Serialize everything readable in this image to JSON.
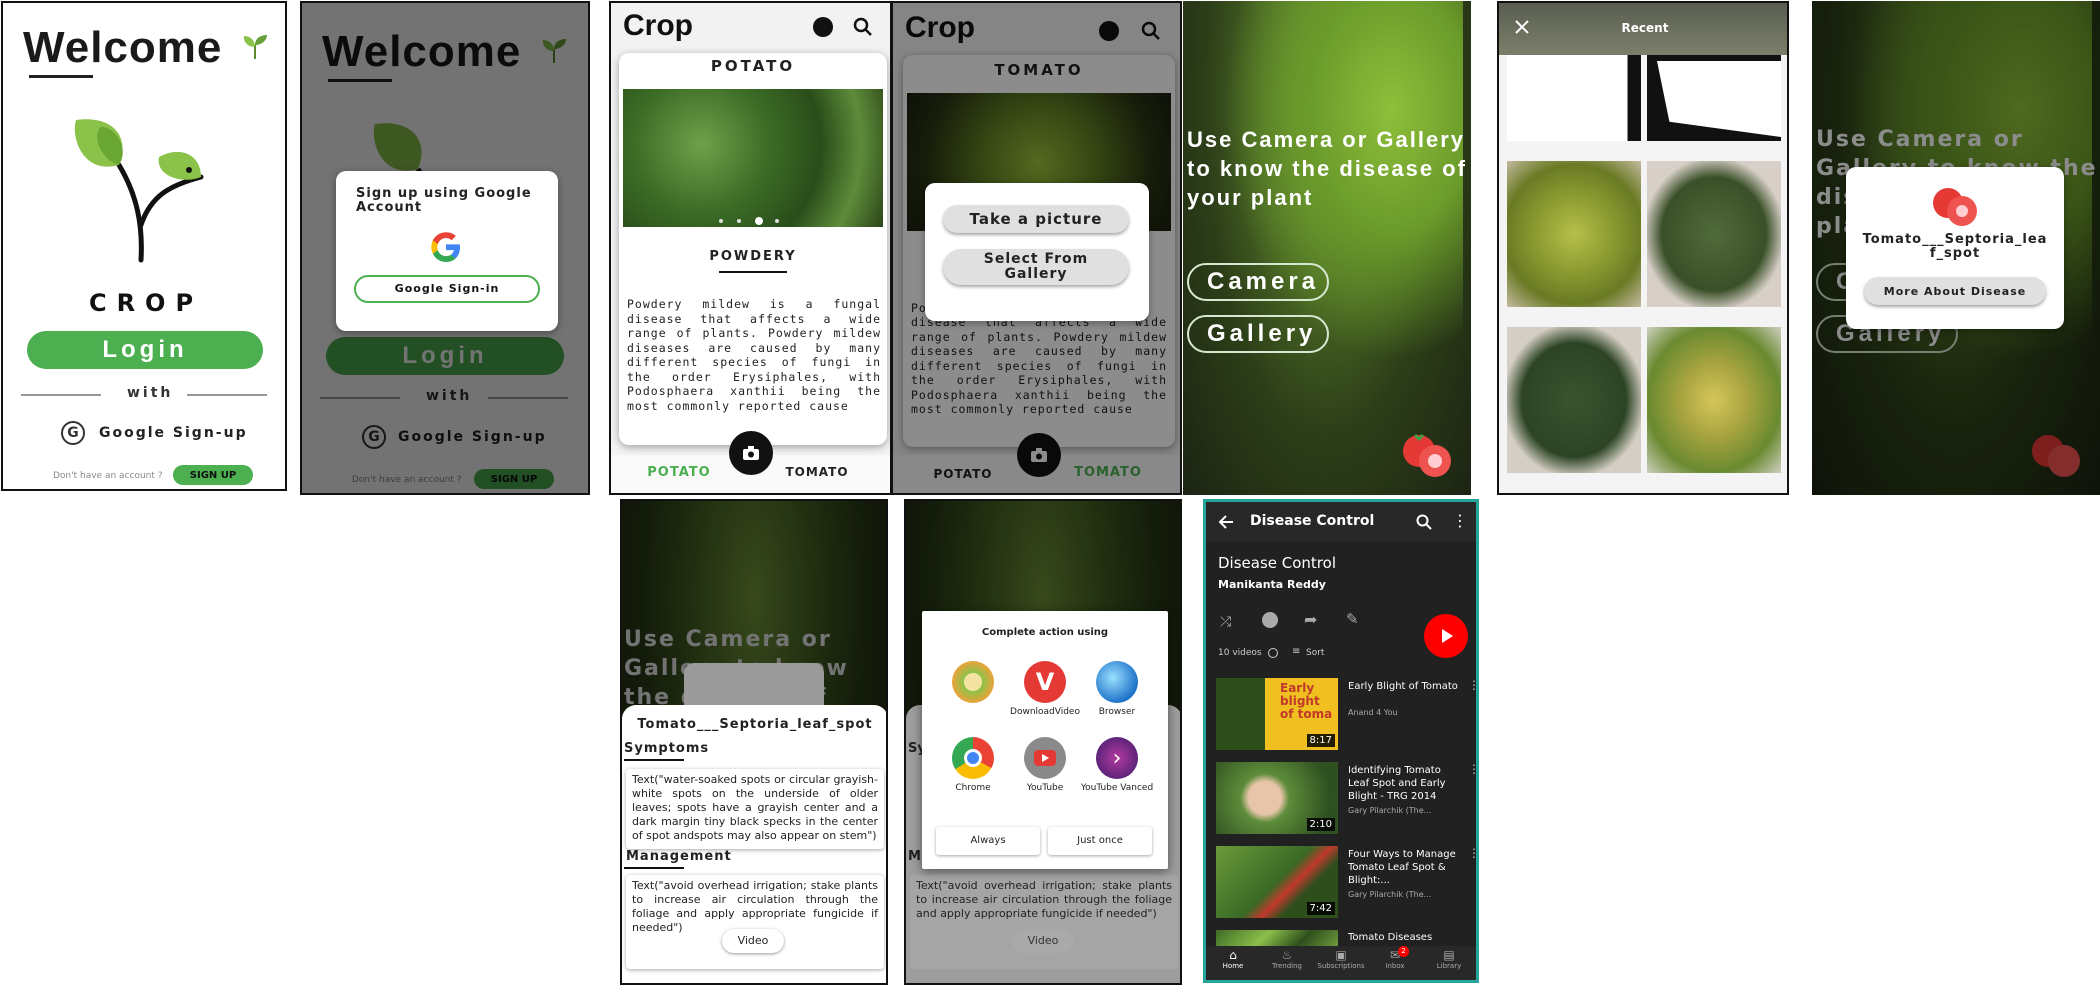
{
  "screen1": {
    "title": "Welcome",
    "brand": "CROP",
    "login": "Login",
    "with": "with",
    "google_signup": "Google Sign-up",
    "no_account": "Don't have an account ?",
    "signup": "SIGN UP",
    "icons": [
      "sprout-icon",
      "plant-logo-icon",
      "google-icon"
    ]
  },
  "screen2": {
    "dialog_title": "Sign up using Google Account",
    "google_signin": "Google Sign-in",
    "icons": [
      "google-g-icon"
    ]
  },
  "screen3": {
    "app_title": "Crop",
    "card_title": "POTATO",
    "disease_title": "POWDERY",
    "desc": "Powdery mildew is a fungal disease that affects a wide range of plants. Powdery mildew diseases are caused by many different species of fungi in the order Erysiphales, with Podosphaera xanthii being the most commonly reported cause",
    "tabs": [
      "POTATO",
      "TOMATO"
    ],
    "icons": [
      "face-icon",
      "search-icon",
      "camera-icon"
    ]
  },
  "screen4": {
    "app_title": "Crop",
    "card_title": "TOMATO",
    "take_picture": "Take a picture",
    "select_gallery": "Select From Gallery",
    "desc": "disease that affects a wide range of plants. Powdery mildew diseases are caused by many different species of fungi in the order Erysiphales, with Podosphaera xanthii being the most commonly reported cause",
    "desc_first": "Po",
    "tabs": [
      "POTATO",
      "TOMATO"
    ]
  },
  "screen5": {
    "headline": "Use Camera or Gallery to know the disease of your plant",
    "camera": "Camera",
    "gallery": "Gallery",
    "icons": [
      "tomato-icon"
    ]
  },
  "screen6": {
    "title": "Recent",
    "icons": [
      "close-icon"
    ]
  },
  "screen7": {
    "disease_name": "Tomato___Septoria_leaf_spot",
    "more": "More About Disease"
  },
  "screen8": {
    "title": "Tomato___Septoria_leaf_spot",
    "symptoms_label": "Symptoms",
    "symptoms_text": "Text(\"water-soaked spots or circular grayish-white spots on the underside of older leaves; spots have a grayish center and a dark margin tiny black specks in the center of spot andspots may also appear on stem\")",
    "management_label": "Management",
    "management_text": "Text(\"avoid overhead irrigation; stake plants to increase air circulation through the foliage and apply appropriate fungicide if needed\")",
    "video": "Video"
  },
  "screen9": {
    "dialog_title": "Complete action using",
    "apps": [
      "",
      "DownloadVideo",
      "Browser",
      "Chrome",
      "YouTube",
      "YouTube Vanced"
    ],
    "always": "Always",
    "just_once": "Just once",
    "sy": "Sy",
    "m": "M",
    "management_text": "Text(\"avoid overhead irrigation; stake plants to increase air circulation through the foliage and apply appropriate fungicide if needed\")",
    "video": "Video"
  },
  "youtube": {
    "header": "Disease Control",
    "playlist_title": "Disease Control",
    "owner": "Manikanta Reddy",
    "count": "10 videos",
    "sort": "Sort",
    "videos": [
      {
        "title": "Early Blight of Tomato",
        "channel": "Anand 4 You",
        "duration": "8:17",
        "thumb_text": "Early blight of toma"
      },
      {
        "title": "Identifying Tomato Leaf Spot and Early Blight - TRG 2014",
        "channel": "Gary Pilarchik (The...",
        "duration": "2:10"
      },
      {
        "title": "Four Ways to Manage Tomato Leaf Spot & Blight:...",
        "channel": "Gary Pilarchik (The...",
        "duration": "7:42"
      },
      {
        "title": "Tomato Diseases",
        "channel": "",
        "duration": ""
      }
    ],
    "nav": [
      "Home",
      "Trending",
      "Subscriptions",
      "Inbox",
      "Library"
    ],
    "inbox_badge": "2",
    "colors": {
      "red": "#ff0000",
      "bg": "#212121"
    }
  }
}
